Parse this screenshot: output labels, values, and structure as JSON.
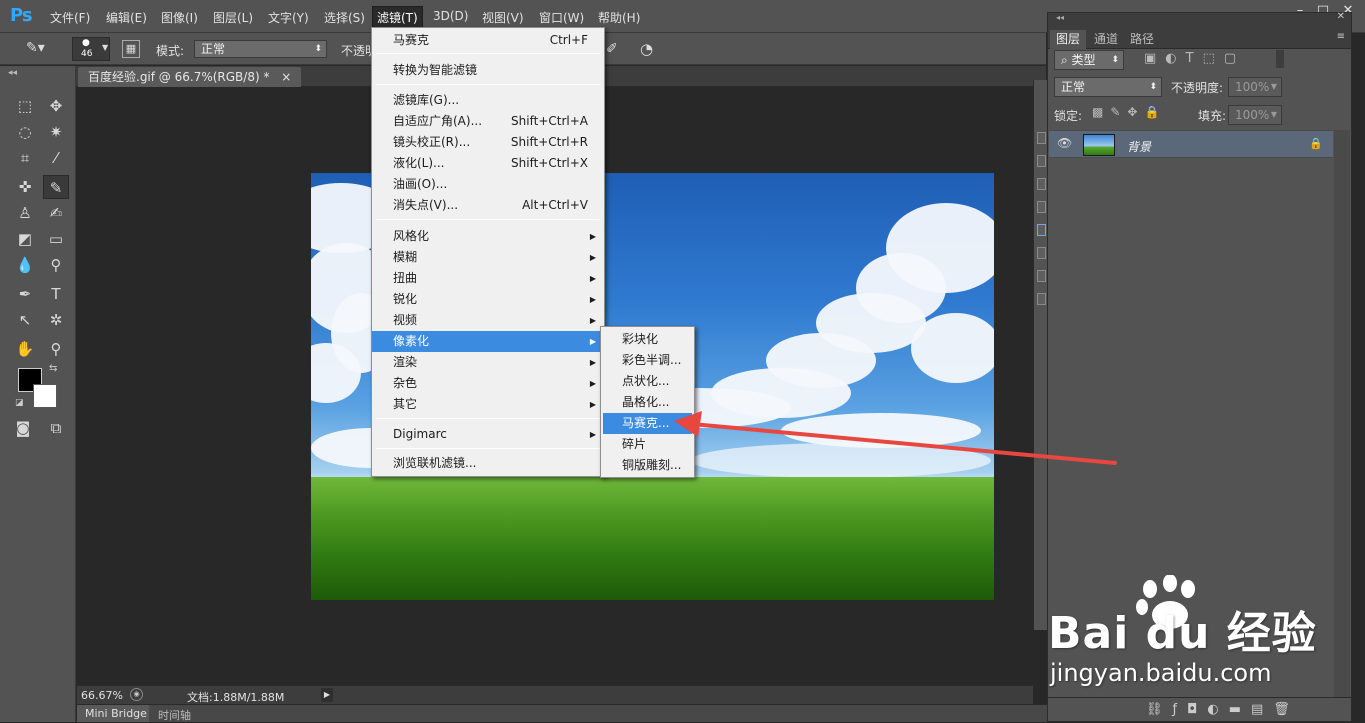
{
  "app": {
    "logo": "Ps"
  },
  "menubar": {
    "items": [
      "文件(F)",
      "编辑(E)",
      "图像(I)",
      "图层(L)",
      "文字(Y)",
      "选择(S)",
      "滤镜(T)",
      "3D(D)",
      "视图(V)",
      "窗口(W)",
      "帮助(H)"
    ],
    "active": "滤镜(T)"
  },
  "optbar": {
    "brush_size": "46",
    "mode_label": "模式:",
    "mode_value": "正常",
    "opacity_label": "不透明"
  },
  "document": {
    "tab_title": "百度经验.gif @ 66.7%(RGB/8) *",
    "close_glyph": "×"
  },
  "status": {
    "zoom": "66.67%",
    "doc_info": "文档:1.88M/1.88M"
  },
  "bottom_tabs": [
    "Mini Bridge",
    "时间轴"
  ],
  "filter_menu": {
    "items": [
      {
        "label": "马赛克",
        "shortcut": "Ctrl+F"
      },
      {
        "label": "转换为智能滤镜"
      },
      {
        "label": "滤镜库(G)..."
      },
      {
        "label": "自适应广角(A)...",
        "shortcut": "Shift+Ctrl+A"
      },
      {
        "label": "镜头校正(R)...",
        "shortcut": "Shift+Ctrl+R"
      },
      {
        "label": "液化(L)...",
        "shortcut": "Shift+Ctrl+X"
      },
      {
        "label": "油画(O)..."
      },
      {
        "label": "消失点(V)...",
        "shortcut": "Alt+Ctrl+V"
      },
      {
        "label": "风格化"
      },
      {
        "label": "模糊"
      },
      {
        "label": "扭曲"
      },
      {
        "label": "锐化"
      },
      {
        "label": "视频"
      },
      {
        "label": "像素化"
      },
      {
        "label": "渲染"
      },
      {
        "label": "杂色"
      },
      {
        "label": "其它"
      },
      {
        "label": "Digimarc"
      },
      {
        "label": "浏览联机滤镜..."
      }
    ],
    "highlighted": "像素化"
  },
  "pixelate_submenu": {
    "items": [
      "彩块化",
      "彩色半调...",
      "点状化...",
      "晶格化...",
      "马赛克...",
      "碎片",
      "铜版雕刻..."
    ],
    "highlighted": "马赛克..."
  },
  "layers_panel": {
    "tabs": [
      "图层",
      "通道",
      "路径"
    ],
    "active_tab": "图层",
    "filter_kind": "类型",
    "blend_mode": "正常",
    "opacity_label": "不透明度:",
    "opacity_value": "100%",
    "lock_label": "锁定:",
    "fill_label": "填充:",
    "fill_value": "100%",
    "layer_name": "背景"
  },
  "watermark": {
    "brand": "Bai du 经验",
    "url": "jingyan.baidu.com"
  },
  "colors": {
    "accent": "#3b8be0",
    "ps_blue": "#31a8ff",
    "arrow": "#e8473f"
  }
}
